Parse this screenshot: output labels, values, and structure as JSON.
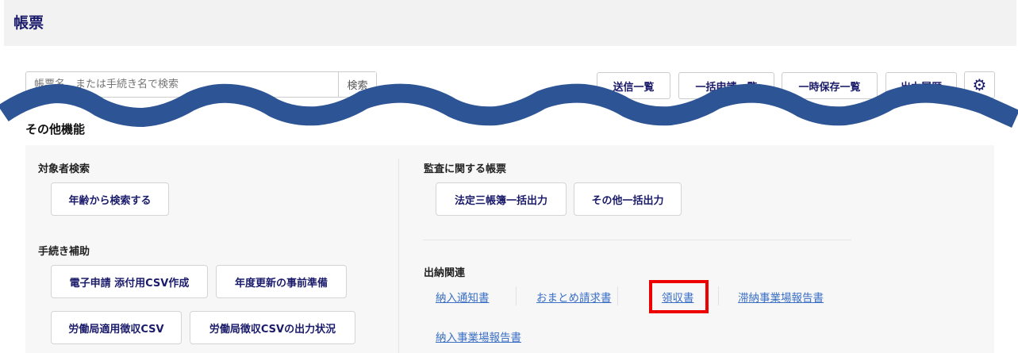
{
  "header": {
    "title": "帳票"
  },
  "search": {
    "placeholder": "帳票名、または手続き名で検索",
    "button": "検索"
  },
  "toolbar": {
    "sent_list": "送信一覧",
    "bulk_apply_list": "一括申請一覧",
    "temp_saved_list": "一時保存一覧",
    "output_history": "出力履歴",
    "settings_icon": "gear-icon"
  },
  "other": {
    "title": "その他機能",
    "target_search": {
      "heading": "対象者検索",
      "buttons": [
        "年齢から検索する"
      ]
    },
    "procedure_help": {
      "heading": "手続き補助",
      "buttons": [
        "電子申請 添付用CSV作成",
        "年度更新の事前準備",
        "労働局適用徴収CSV",
        "労働局徴収CSVの出力状況"
      ]
    },
    "audit": {
      "heading": "監査に関する帳票",
      "buttons": [
        "法定三帳簿一括出力",
        "その他一括出力"
      ]
    },
    "payments": {
      "heading": "出納関連",
      "links": [
        "納入通知書",
        "おまとめ請求書",
        "領収書",
        "滞納事業場報告書",
        "納入事業場報告書"
      ],
      "highlighted": "領収書"
    }
  },
  "colors": {
    "navy": "#1b1b6b",
    "link": "#3a6fc4",
    "wave": "#2d5494",
    "highlight": "#ee0000"
  }
}
